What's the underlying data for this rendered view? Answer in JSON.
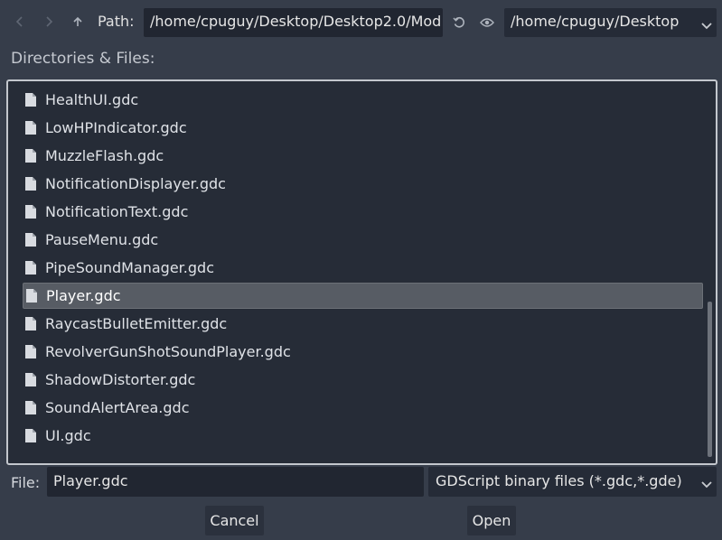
{
  "toolbar": {
    "path_label": "Path:",
    "path_value": "/home/cpuguy/Desktop/Desktop2.0/Mod",
    "drive_value": "/home/cpuguy/Desktop",
    "icons": [
      "back-arrow",
      "forward-arrow",
      "up-arrow",
      "refresh",
      "eye"
    ]
  },
  "section": {
    "title": "Directories & Files:"
  },
  "files": [
    {
      "name": "HealthUI.gdc"
    },
    {
      "name": "LowHPIndicator.gdc"
    },
    {
      "name": "MuzzleFlash.gdc"
    },
    {
      "name": "NotificationDisplayer.gdc"
    },
    {
      "name": "NotificationText.gdc"
    },
    {
      "name": "PauseMenu.gdc"
    },
    {
      "name": "PipeSoundManager.gdc"
    },
    {
      "name": "Player.gdc",
      "selected": true
    },
    {
      "name": "RaycastBulletEmitter.gdc"
    },
    {
      "name": "RevolverGunShotSoundPlayer.gdc"
    },
    {
      "name": "ShadowDistorter.gdc"
    },
    {
      "name": "SoundAlertArea.gdc"
    },
    {
      "name": "UI.gdc"
    }
  ],
  "footer": {
    "file_label": "File:",
    "file_value": "Player.gdc",
    "filter_value": "GDScript binary files (*.gdc,*.gde)",
    "cancel_label": "Cancel",
    "open_label": "Open"
  },
  "colors": {
    "background": "#363d4a",
    "input_bg": "#212631",
    "selected_row": "#575c64"
  }
}
